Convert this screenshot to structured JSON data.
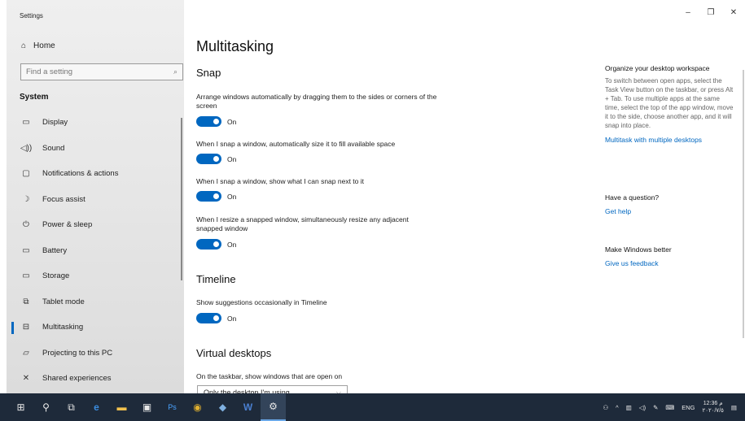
{
  "window": {
    "title": "Settings",
    "controls": [
      "–",
      "❐",
      "✕"
    ]
  },
  "sidebar": {
    "home_label": "Home",
    "search_placeholder": "Find a setting",
    "section_label": "System",
    "items": [
      {
        "label": "Display",
        "icon": "display-icon",
        "glyph": "▭"
      },
      {
        "label": "Sound",
        "icon": "sound-icon",
        "glyph": "🔈"
      },
      {
        "label": "Notifications & actions",
        "icon": "notifications-icon",
        "glyph": "▢"
      },
      {
        "label": "Focus assist",
        "icon": "focus-assist-icon",
        "glyph": "☽"
      },
      {
        "label": "Power & sleep",
        "icon": "power-icon",
        "glyph": "⏻"
      },
      {
        "label": "Battery",
        "icon": "battery-icon",
        "glyph": "▭"
      },
      {
        "label": "Storage",
        "icon": "storage-icon",
        "glyph": "▭"
      },
      {
        "label": "Tablet mode",
        "icon": "tablet-mode-icon",
        "glyph": "⧉"
      },
      {
        "label": "Multitasking",
        "icon": "multitasking-icon",
        "glyph": "⊟",
        "active": true
      },
      {
        "label": "Projecting to this PC",
        "icon": "projecting-icon",
        "glyph": "▱"
      },
      {
        "label": "Shared experiences",
        "icon": "shared-experiences-icon",
        "glyph": "✕"
      }
    ]
  },
  "main": {
    "title": "Multitasking",
    "snap": {
      "heading": "Snap",
      "settings": [
        {
          "desc": "Arrange windows automatically by dragging them to the sides or corners of the screen",
          "state": "On"
        },
        {
          "desc": "When I snap a window, automatically size it to fill available space",
          "state": "On"
        },
        {
          "desc": "When I snap a window, show what I can snap next to it",
          "state": "On"
        },
        {
          "desc": "When I resize a snapped window, simultaneously resize any adjacent snapped window",
          "state": "On"
        }
      ]
    },
    "timeline": {
      "heading": "Timeline",
      "setting": {
        "desc": "Show suggestions occasionally in Timeline",
        "state": "On"
      }
    },
    "virtual_desktops": {
      "heading": "Virtual desktops",
      "desc": "On the taskbar, show windows that are open on",
      "select_value": "Only the desktop I'm using"
    }
  },
  "right_panel": {
    "organize_heading": "Organize your desktop workspace",
    "organize_text": "To switch between open apps, select the Task View button on the taskbar, or press Alt + Tab. To use multiple apps at the same time, select the top of the app window, move it to the side, choose another app, and it will snap into place.",
    "organize_link": "Multitask with multiple desktops",
    "question_heading": "Have a question?",
    "help_link": "Get help",
    "better_heading": "Make Windows better",
    "feedback_link": "Give us feedback"
  },
  "taskbar": {
    "icons": [
      "start-icon",
      "search-icon",
      "task-view-icon",
      "edge-icon",
      "file-explorer-icon",
      "store-icon",
      "photoshop-icon",
      "chrome-icon",
      "app-icon",
      "word-icon",
      "settings-icon"
    ],
    "tray_lang": "ENG",
    "clock_time": "12:36 م",
    "clock_date": "٢٠٢٠/٧/٥"
  }
}
